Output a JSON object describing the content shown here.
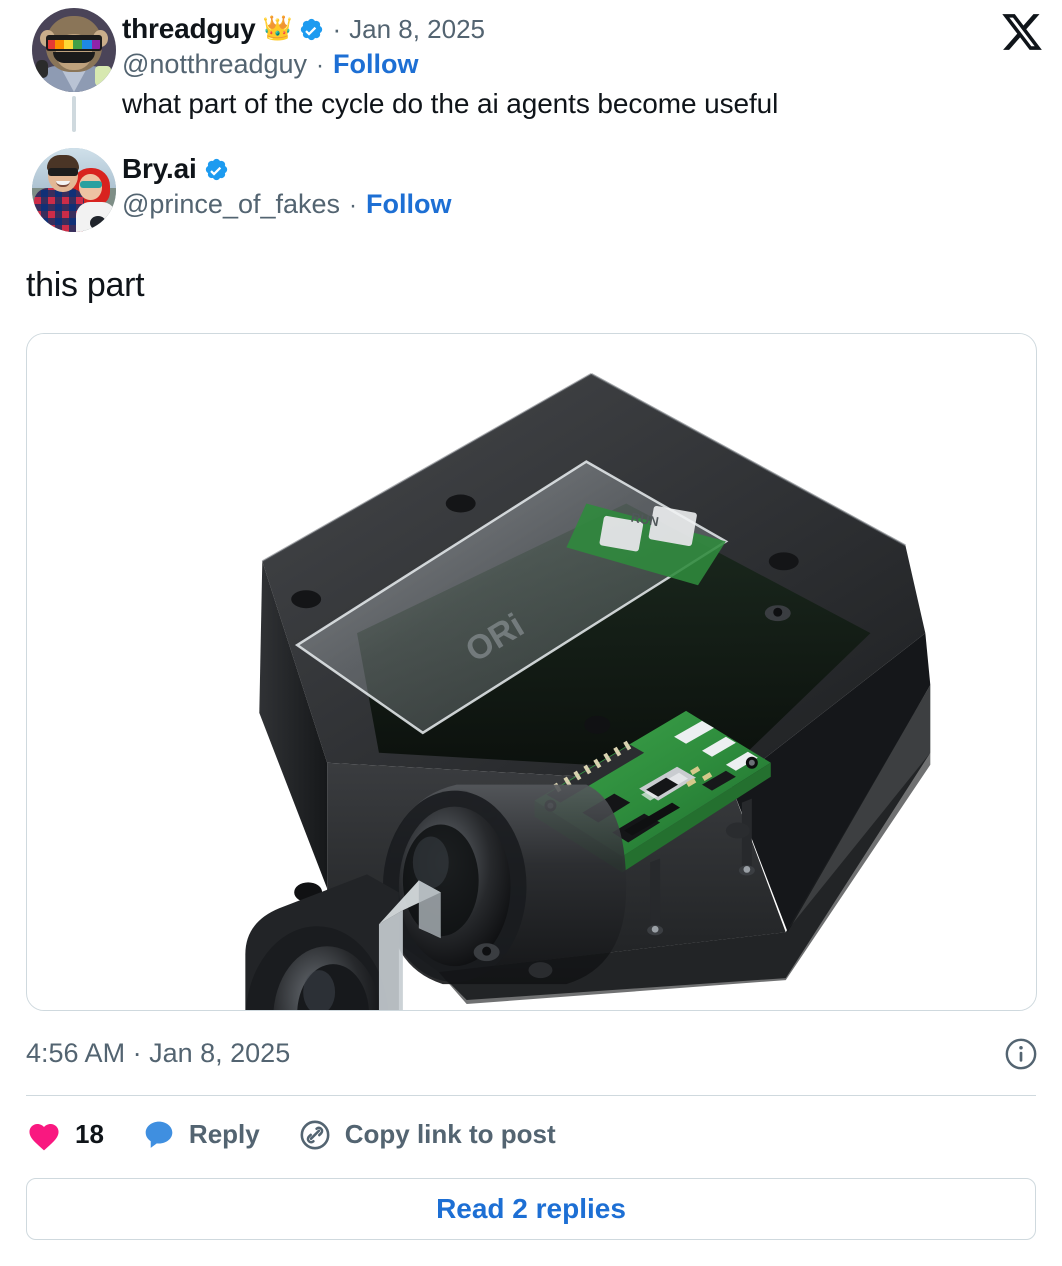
{
  "brand": {
    "logo_name": "x-logo",
    "accent_blue": "#1d6fd4",
    "like_pink": "#f91880",
    "reply_blue": "#3f8fe0",
    "muted_gray": "#536471",
    "border_gray": "#cfd9de"
  },
  "parent_tweet": {
    "avatar_name": "ape-avatar",
    "display_name": "threadguy",
    "crown": "👑",
    "verified_badge": "verified-badge-blue",
    "separator": "·",
    "date": "Jan 8, 2025",
    "handle": "@notthreadguy",
    "follow_label": "Follow",
    "text": "what part of the cycle do the ai agents become useful"
  },
  "main_tweet": {
    "avatar_name": "couple-photo-avatar",
    "display_name": "Bry.ai",
    "verified_badge": "verified-badge-blue",
    "handle": "@prince_of_fakes",
    "separator": "·",
    "follow_label": "Follow",
    "text": "this part",
    "media": {
      "alt_name": "camera-enclosure-cutaway-render",
      "description": "3D cutaway render of a black camera enclosure with transparent cover showing a green Raspberry Pi board and internal lens barrel",
      "board_color": "#2f8f3e",
      "body_color": "#2b2b2d",
      "silkscreen_text": "ORI"
    },
    "timestamp": "4:56 AM",
    "timestamp_separator": "·",
    "timestamp_date": "Jan 8, 2025",
    "info_icon_name": "info-circle-icon"
  },
  "actions": {
    "like": {
      "icon_name": "heart-icon",
      "count": "18"
    },
    "reply": {
      "icon_name": "reply-bubble-icon",
      "label": "Reply"
    },
    "copy_link": {
      "icon_name": "link-chain-icon",
      "label": "Copy link to post"
    }
  },
  "read_replies": {
    "label": "Read 2 replies"
  }
}
